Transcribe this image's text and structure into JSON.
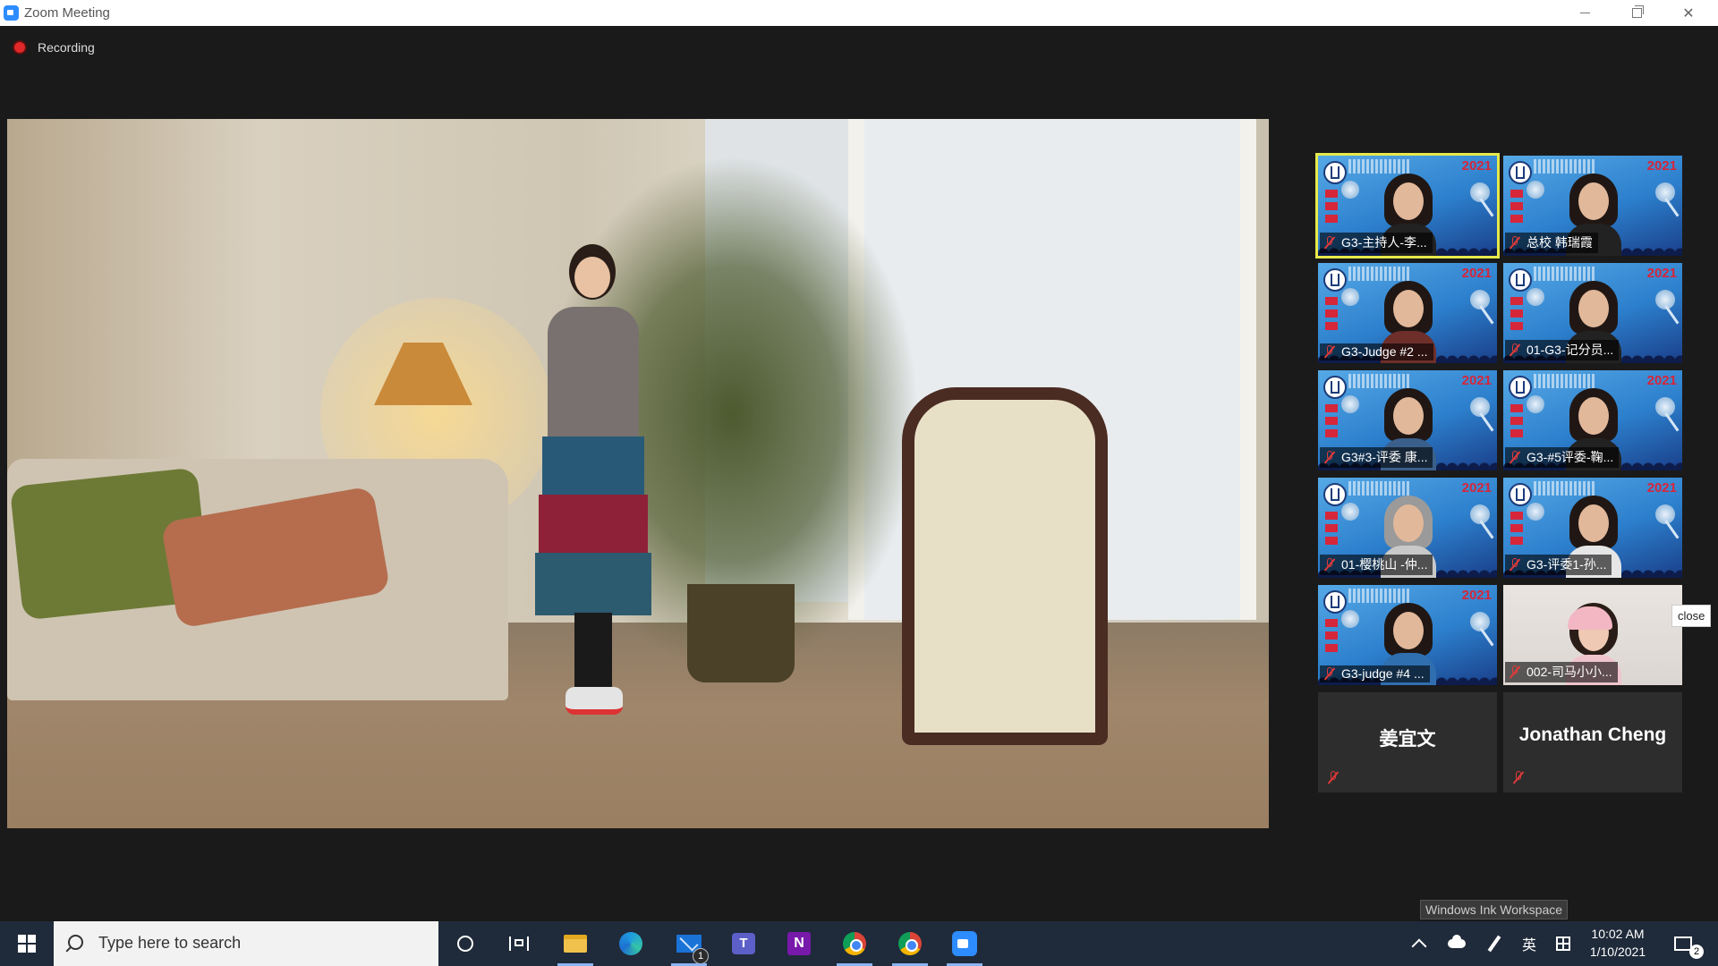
{
  "window": {
    "title": "Zoom Meeting"
  },
  "meeting": {
    "recording_label": "Recording",
    "gallery": [
      {
        "name": "G3-主持人-李...",
        "type": "video",
        "active": true
      },
      {
        "name": "总校 韩瑞霞",
        "type": "video",
        "active": false
      },
      {
        "name": "G3-Judge #2 ...",
        "type": "video",
        "active": false
      },
      {
        "name": "01-G3-记分员...",
        "type": "video",
        "active": false
      },
      {
        "name": "G3#3-评委 康...",
        "type": "video",
        "active": false
      },
      {
        "name": "G3-#5评委-鞠...",
        "type": "video",
        "active": false
      },
      {
        "name": "01-樱桃山 -仲...",
        "type": "video",
        "active": false
      },
      {
        "name": "G3-评委1-孙...",
        "type": "video",
        "active": false
      },
      {
        "name": "G3-judge #4 ...",
        "type": "video",
        "active": false
      },
      {
        "name": "002-司马小小...",
        "type": "photo",
        "active": false
      },
      {
        "name": "姜宜文",
        "type": "name-only",
        "active": false
      },
      {
        "name": "Jonathan Cheng",
        "type": "name-only",
        "active": false
      }
    ],
    "tile_banner_year": "2021",
    "close_tooltip": "close"
  },
  "taskbar": {
    "search_placeholder": "Type here to search",
    "mail_badge": "1",
    "ink_workspace_tooltip": "Windows Ink Workspace",
    "ime_label": "英",
    "time": "10:02 AM",
    "date": "1/10/2021",
    "notification_count": "2"
  }
}
